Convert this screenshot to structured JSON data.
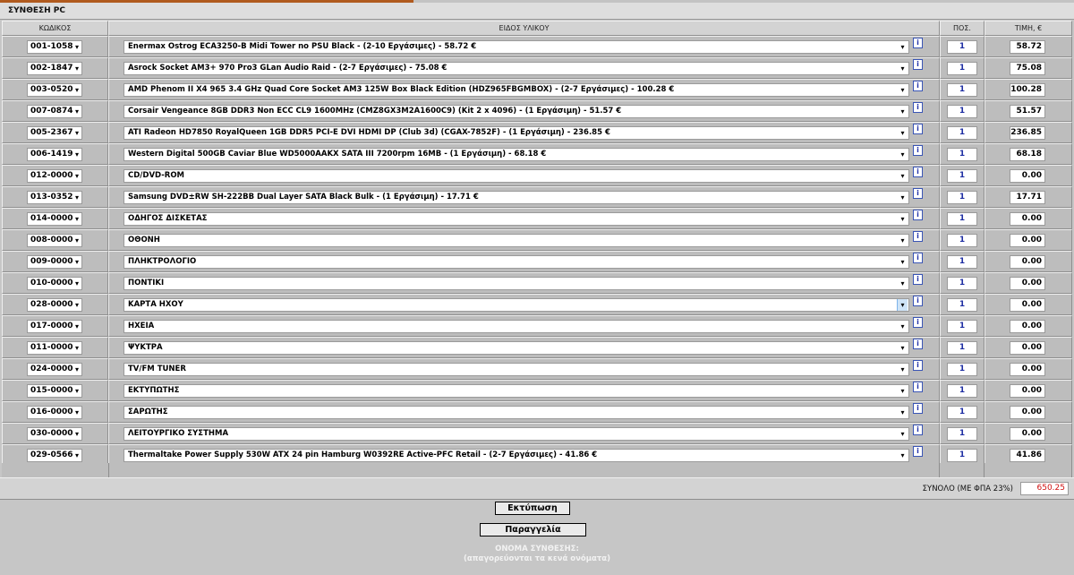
{
  "header": {
    "title": "ΣΥΝΘΕΣΗ PC"
  },
  "columns": {
    "code": "ΚΩΔΙΚΟΣ",
    "item": "ΕΙΔΟΣ ΥΛΙΚΟΥ",
    "qty": "ΠΟΣ.",
    "price": "ΤΙΜΗ, €"
  },
  "info_label": "i",
  "dropdown_glyph": "▾",
  "rows": [
    {
      "code": "001-1058",
      "item": "Enermax Ostrog ECA3250-B Midi Tower no PSU Black - (2-10 Εργάσιμες) - 58.72 €",
      "qty": "1",
      "price": "58.72"
    },
    {
      "code": "002-1847",
      "item": "Asrock Socket AM3+ 970 Pro3 GLan Audio Raid - (2-7 Εργάσιμες) - 75.08 €",
      "qty": "1",
      "price": "75.08"
    },
    {
      "code": "003-0520",
      "item": "AMD Phenom II X4 965 3.4 GHz Quad Core Socket AM3 125W Box Black Edition (HDZ965FBGMBOX) - (2-7 Εργάσιμες) - 100.28 €",
      "qty": "1",
      "price": "100.28"
    },
    {
      "code": "007-0874",
      "item": "Corsair Vengeance 8GB DDR3 Non ECC CL9 1600MHz (CMZ8GX3M2A1600C9) (Kit 2 x 4096) - (1 Εργάσιμη) - 51.57 €",
      "qty": "1",
      "price": "51.57"
    },
    {
      "code": "005-2367",
      "item": "ATI Radeon HD7850 RoyalQueen 1GB DDR5 PCI-E DVI HDMI DP (Club 3d) (CGAX-7852F) - (1 Εργάσιμη) - 236.85 €",
      "qty": "1",
      "price": "236.85"
    },
    {
      "code": "006-1419",
      "item": "Western Digital 500GB Caviar Blue WD5000AAKX SATA III 7200rpm 16MB - (1 Εργάσιμη) - 68.18 €",
      "qty": "1",
      "price": "68.18"
    },
    {
      "code": "012-0000",
      "item": "CD/DVD-ROM",
      "qty": "1",
      "price": "0.00"
    },
    {
      "code": "013-0352",
      "item": "Samsung DVD±RW SH-222BB Dual Layer SATA Black Bulk - (1 Εργάσιμη) - 17.71 €",
      "qty": "1",
      "price": "17.71"
    },
    {
      "code": "014-0000",
      "item": "ΟΔΗΓΟΣ ΔΙΣΚΕΤΑΣ",
      "qty": "1",
      "price": "0.00"
    },
    {
      "code": "008-0000",
      "item": "ΟΘΟΝΗ",
      "qty": "1",
      "price": "0.00"
    },
    {
      "code": "009-0000",
      "item": "ΠΛΗΚΤΡΟΛΟΓΙΟ",
      "qty": "1",
      "price": "0.00"
    },
    {
      "code": "010-0000",
      "item": "ΠΟΝΤΙΚΙ",
      "qty": "1",
      "price": "0.00"
    },
    {
      "code": "028-0000",
      "item": "ΚΑΡΤΑ ΗΧΟΥ",
      "qty": "1",
      "price": "0.00",
      "active": true
    },
    {
      "code": "017-0000",
      "item": "ΗΧΕΙΑ",
      "qty": "1",
      "price": "0.00"
    },
    {
      "code": "011-0000",
      "item": "ΨΥΚΤΡΑ",
      "qty": "1",
      "price": "0.00"
    },
    {
      "code": "024-0000",
      "item": "TV/FM TUNER",
      "qty": "1",
      "price": "0.00"
    },
    {
      "code": "015-0000",
      "item": "ΕΚΤΥΠΩΤΗΣ",
      "qty": "1",
      "price": "0.00"
    },
    {
      "code": "016-0000",
      "item": "ΣΑΡΩΤΗΣ",
      "qty": "1",
      "price": "0.00"
    },
    {
      "code": "030-0000",
      "item": "ΛΕΙΤΟΥΡΓΙΚΟ ΣΥΣΤΗΜΑ",
      "qty": "1",
      "price": "0.00"
    },
    {
      "code": "029-0566",
      "item": "Thermaltake Power Supply 530W ATX 24 pin Hamburg W0392RE Active-PFC Retail - (2-7 Εργάσιμες) - 41.86 €",
      "qty": "1",
      "price": "41.86"
    }
  ],
  "total": {
    "label": "ΣΥΝΟΛΟ (ΜΕ ΦΠΑ 23%)",
    "value": "650.25"
  },
  "buttons": {
    "print": "Εκτύπωση",
    "order": "Παραγγελία"
  },
  "config_name": {
    "label": "ΟΝΟΜΑ ΣΥΝΘΕΣΗΣ:",
    "hint": "(απαγορεύονται τα κενά ονόματα)"
  },
  "colors": {
    "accent": "#b05a1e",
    "total_value": "#d01010",
    "qty_text": "#1f2fa3",
    "background": "#c6c6c6"
  }
}
